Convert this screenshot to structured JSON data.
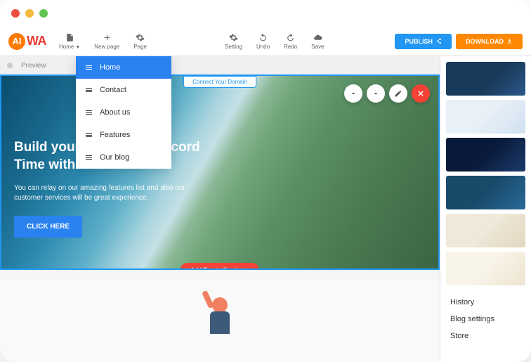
{
  "logo": {
    "badge": "AI",
    "text": "WA"
  },
  "toolbar": {
    "left": [
      {
        "icon": "file",
        "label": "Home"
      },
      {
        "icon": "plus",
        "label": "New page"
      },
      {
        "icon": "gear",
        "label": "Page"
      }
    ],
    "center": [
      {
        "icon": "gear",
        "label": "Setting"
      },
      {
        "icon": "undo",
        "label": "Undo"
      },
      {
        "icon": "redo",
        "label": "Redo"
      },
      {
        "icon": "cloud",
        "label": "Save"
      }
    ],
    "publish": "PUBLISH",
    "download": "DOWNLOAD"
  },
  "preview_label": "Preview",
  "dropdown": {
    "items": [
      {
        "label": "Home",
        "active": true
      },
      {
        "label": "Contact",
        "active": false
      },
      {
        "label": "About us",
        "active": false
      },
      {
        "label": "Features",
        "active": false
      },
      {
        "label": "Our blog",
        "active": false
      }
    ]
  },
  "hero": {
    "connect": "Connect Your Domain",
    "title": "Build your Website in Record Time with Aiwa",
    "subtitle": "You can relay on our amazing features list and also our customer services will be great experience.",
    "cta": "CLICK HERE",
    "add_section": "Add Empty Section +"
  },
  "sidebar": {
    "links": [
      "History",
      "Blog settings",
      "Store"
    ]
  }
}
